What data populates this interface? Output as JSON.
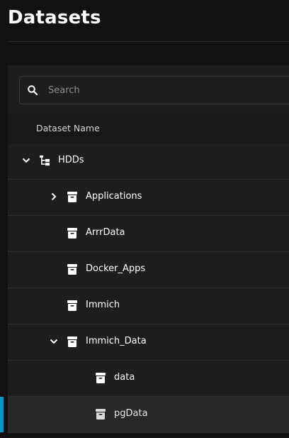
{
  "header": {
    "title": "Datasets"
  },
  "search": {
    "placeholder": "Search"
  },
  "table": {
    "column_name": "Dataset Name",
    "rows": [
      {
        "name": "HDDs"
      },
      {
        "name": "Applications"
      },
      {
        "name": "ArrrData"
      },
      {
        "name": "Docker_Apps"
      },
      {
        "name": "Immich"
      },
      {
        "name": "Immich_Data"
      },
      {
        "name": "data"
      },
      {
        "name": "pgData"
      }
    ]
  },
  "colors": {
    "accent": "#0095d5",
    "background": "#121212",
    "panel": "#1e1e1e"
  },
  "icons": {
    "expand": "chevron-down-icon",
    "collapse": "chevron-right-icon",
    "pool": "pool-tree-icon",
    "dataset": "dataset-icon",
    "search": "search-icon"
  }
}
